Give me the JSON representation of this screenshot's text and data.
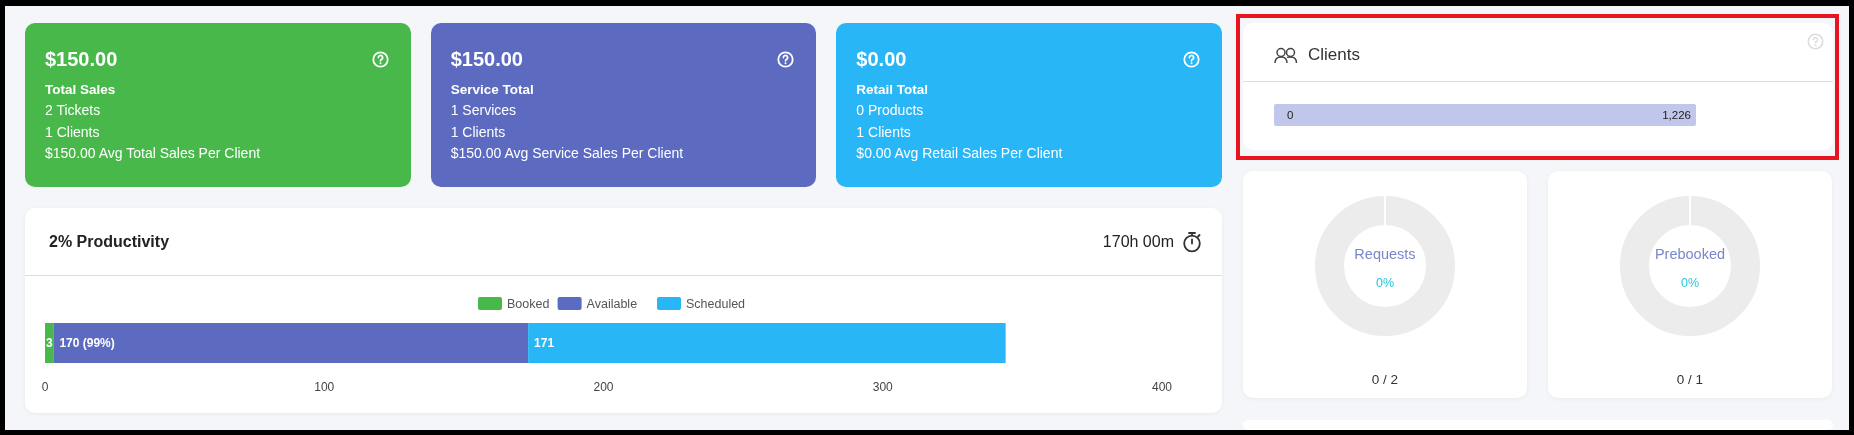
{
  "summary_cards": [
    {
      "amount": "$150.00",
      "title": "Total Sales",
      "lines": [
        "2 Tickets",
        "1 Clients",
        "$150.00 Avg Total Sales Per Client"
      ],
      "color": "#48b84b"
    },
    {
      "amount": "$150.00",
      "title": "Service Total",
      "lines": [
        "1 Services",
        "1 Clients",
        "$150.00 Avg Service Sales Per Client"
      ],
      "color": "#5c6bc0"
    },
    {
      "amount": "$0.00",
      "title": "Retail Total",
      "lines": [
        "0 Products",
        "1 Clients",
        "$0.00 Avg Retail Sales Per Client"
      ],
      "color": "#29b6f6"
    }
  ],
  "productivity": {
    "title": "2% Productivity",
    "hours": "170h 00m",
    "chart_data": {
      "type": "bar",
      "orientation": "horizontal",
      "stacked": true,
      "legend": true,
      "series": [
        {
          "name": "Booked",
          "color": "#48b84b",
          "values": [
            3
          ]
        },
        {
          "name": "Available",
          "color": "#5c6bc0",
          "values": [
            170
          ]
        },
        {
          "name": "Scheduled",
          "color": "#29b6f6",
          "values": [
            171
          ]
        }
      ],
      "value_labels": [
        "3",
        "170 (99%)",
        "171"
      ],
      "xlim": [
        0,
        400
      ],
      "xticks": [
        0,
        100,
        200,
        300,
        400
      ]
    }
  },
  "clients": {
    "title": "Clients",
    "min": "0",
    "max": "1,226",
    "highlighted": true
  },
  "rings": [
    {
      "label": "Requests",
      "percent": "0%",
      "count": "0 / 2"
    },
    {
      "label": "Prebooked",
      "percent": "0%",
      "count": "0 / 1"
    }
  ]
}
